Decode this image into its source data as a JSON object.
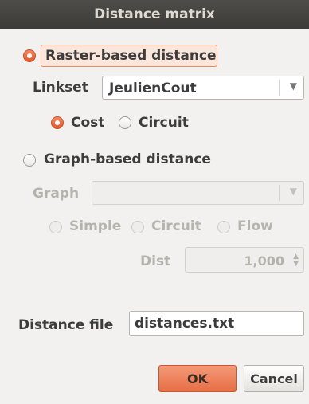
{
  "window": {
    "title": "Distance matrix"
  },
  "raster": {
    "label": "Raster-based distance",
    "selected": true,
    "linkset_label": "Linkset",
    "linkset_value": "JeulienCout",
    "options": [
      {
        "label": "Cost",
        "selected": true
      },
      {
        "label": "Circuit",
        "selected": false
      }
    ]
  },
  "graph": {
    "label": "Graph-based distance",
    "selected": false,
    "graph_label": "Graph",
    "graph_value": "",
    "options": [
      {
        "label": "Simple",
        "selected": false
      },
      {
        "label": "Circuit",
        "selected": false
      },
      {
        "label": "Flow",
        "selected": false
      }
    ],
    "dist_label": "Dist",
    "dist_value": "1,000"
  },
  "distance_file": {
    "label": "Distance file",
    "value": "distances.txt"
  },
  "buttons": {
    "ok": "OK",
    "cancel": "Cancel"
  },
  "colors": {
    "accent": "#e76f46",
    "titlebar": "#3c3b37"
  }
}
